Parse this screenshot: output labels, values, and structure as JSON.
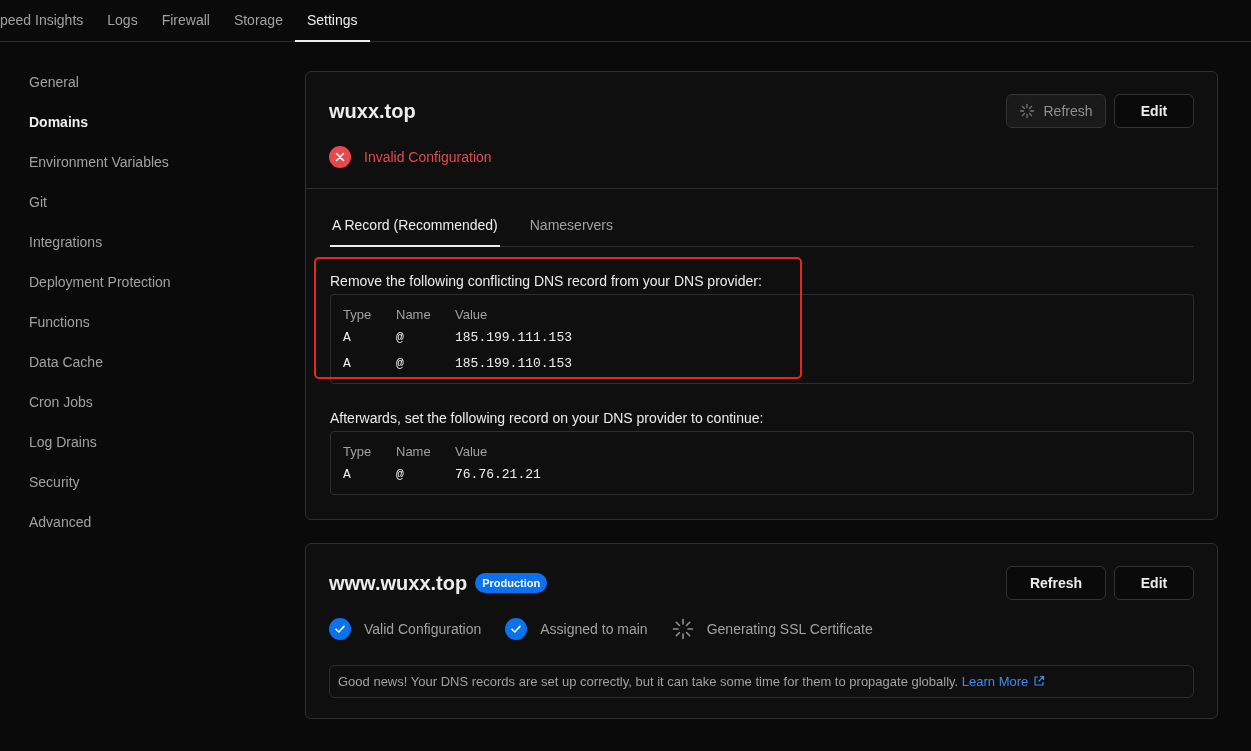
{
  "nav_tabs": [
    {
      "label": "peed Insights",
      "selected": false
    },
    {
      "label": "Logs",
      "selected": false
    },
    {
      "label": "Firewall",
      "selected": false
    },
    {
      "label": "Storage",
      "selected": false
    },
    {
      "label": "Settings",
      "selected": true
    }
  ],
  "sidebar": {
    "items": [
      {
        "label": "General",
        "selected": false
      },
      {
        "label": "Domains",
        "selected": true
      },
      {
        "label": "Environment Variables",
        "selected": false
      },
      {
        "label": "Git",
        "selected": false
      },
      {
        "label": "Integrations",
        "selected": false
      },
      {
        "label": "Deployment Protection",
        "selected": false
      },
      {
        "label": "Functions",
        "selected": false
      },
      {
        "label": "Data Cache",
        "selected": false
      },
      {
        "label": "Cron Jobs",
        "selected": false
      },
      {
        "label": "Log Drains",
        "selected": false
      },
      {
        "label": "Security",
        "selected": false
      },
      {
        "label": "Advanced",
        "selected": false
      }
    ]
  },
  "domains": [
    {
      "name": "wuxx.top",
      "buttons": [
        {
          "label": "Refresh",
          "loading": true,
          "disabled": true
        },
        {
          "label": "Edit",
          "loading": false,
          "disabled": false
        }
      ],
      "statuses": [
        {
          "kind": "error",
          "label": "Invalid Configuration"
        }
      ],
      "record_tabs": [
        {
          "label": "A Record (Recommended)",
          "selected": true
        },
        {
          "label": "Nameservers",
          "selected": false
        }
      ],
      "record_sections": [
        {
          "text": "Remove the following conflicting DNS record from your DNS provider:",
          "highlighted": true,
          "columns": [
            "Type",
            "Name",
            "Value"
          ],
          "rows": [
            [
              "A",
              "@",
              "185.199.111.153"
            ],
            [
              "A",
              "@",
              "185.199.110.153"
            ]
          ]
        },
        {
          "text": "Afterwards, set the following record on your DNS provider to continue:",
          "highlighted": false,
          "columns": [
            "Type",
            "Name",
            "Value"
          ],
          "rows": [
            [
              "A",
              "@",
              "76.76.21.21"
            ]
          ]
        }
      ]
    },
    {
      "name": "www.wuxx.top",
      "badge": "Production",
      "buttons": [
        {
          "label": "Refresh",
          "loading": false,
          "disabled": false
        },
        {
          "label": "Edit",
          "loading": false,
          "disabled": false
        }
      ],
      "statuses": [
        {
          "kind": "check",
          "label": "Valid Configuration"
        },
        {
          "kind": "check",
          "label": "Assigned to main"
        },
        {
          "kind": "pending",
          "label": "Generating SSL Certificate"
        }
      ],
      "notice": {
        "text": "Good news! Your DNS records are set up correctly, but it can take some time for them to propagate globally.",
        "link": "Learn More"
      }
    }
  ]
}
